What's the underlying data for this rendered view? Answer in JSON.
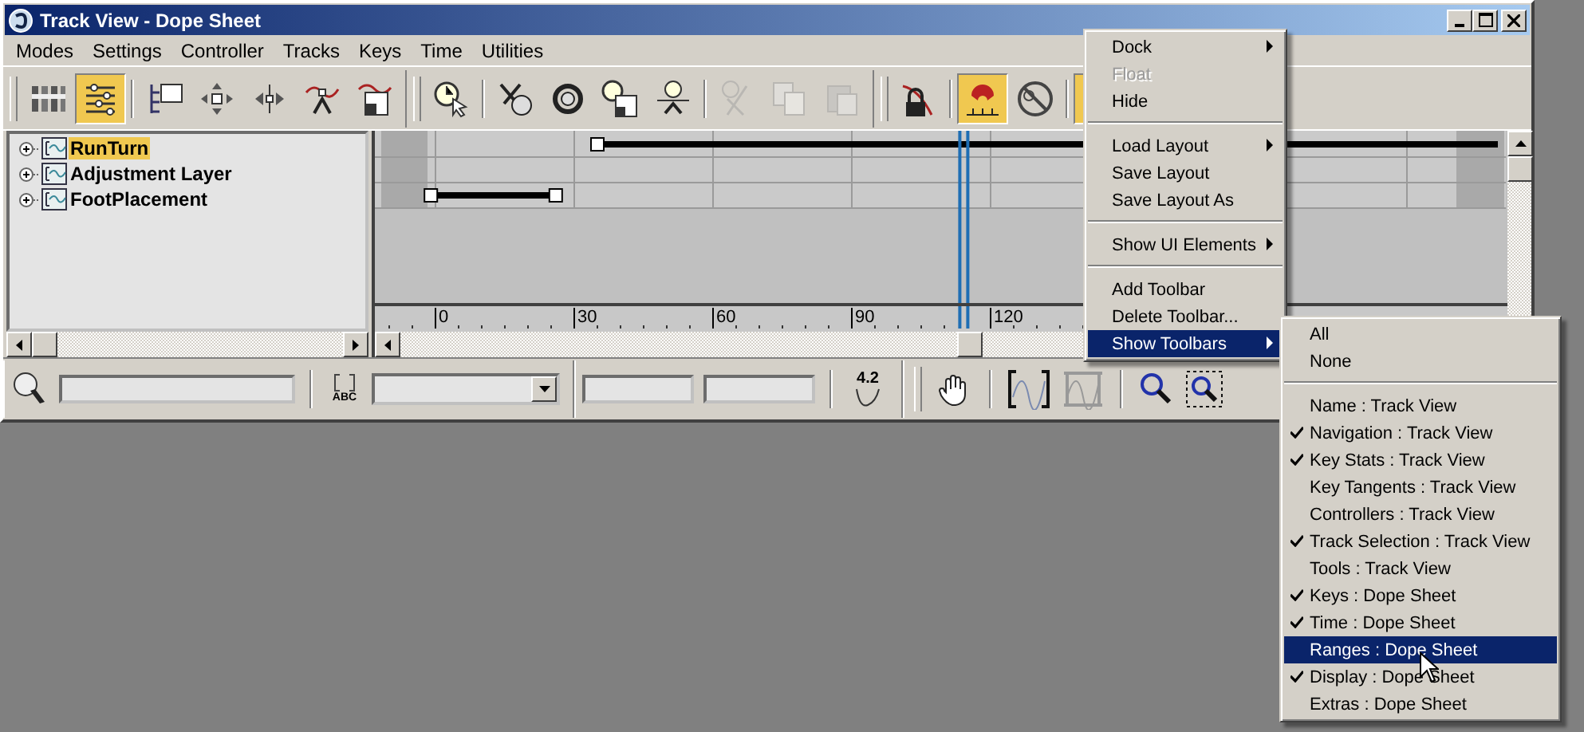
{
  "window": {
    "title": "Track View - Dope Sheet"
  },
  "menubar": [
    {
      "label": "Modes"
    },
    {
      "label": "Settings"
    },
    {
      "label": "Controller"
    },
    {
      "label": "Tracks"
    },
    {
      "label": "Keys"
    },
    {
      "label": "Time"
    },
    {
      "label": "Utilities"
    }
  ],
  "toolbars": [
    {
      "groups": [
        [
          {
            "active": false,
            "disabled": false
          },
          {
            "active": true,
            "disabled": false
          }
        ],
        [
          {
            "active": false,
            "disabled": false
          },
          {
            "active": false,
            "disabled": false
          },
          {
            "active": false,
            "disabled": false
          },
          {
            "active": false,
            "disabled": false
          },
          {
            "active": false,
            "disabled": false
          }
        ]
      ]
    },
    {
      "groups": [
        [
          {
            "active": false,
            "disabled": false
          }
        ],
        [
          {
            "active": false,
            "disabled": false
          },
          {
            "active": false,
            "disabled": false
          },
          {
            "active": false,
            "disabled": false
          },
          {
            "active": false,
            "disabled": false
          }
        ],
        [
          {
            "active": false,
            "disabled": true
          },
          {
            "active": false,
            "disabled": true
          },
          {
            "active": false,
            "disabled": true
          }
        ]
      ]
    },
    {
      "groups": [
        [
          {
            "active": false,
            "disabled": false
          }
        ],
        [
          {
            "active": true,
            "disabled": false
          },
          {
            "active": false,
            "disabled": false
          }
        ],
        [
          {
            "active": true
          }
        ]
      ]
    }
  ],
  "tree": [
    {
      "label": "RunTurn",
      "expanded": false,
      "selected": true
    },
    {
      "label": "Adjustment Layer",
      "expanded": false,
      "selected": false
    },
    {
      "label": "FootPlacement",
      "expanded": false,
      "selected": false
    }
  ],
  "ruler": [
    "0",
    "30",
    "60",
    "90",
    "120"
  ],
  "bottom_toolbar": {
    "name_icon_text": "ABC",
    "value_icon_text": "4.2"
  },
  "context_menu": [
    {
      "kind": "item",
      "label": "Dock",
      "submenu": true,
      "disabled": false,
      "selected": false
    },
    {
      "kind": "item",
      "label": "Float",
      "submenu": false,
      "disabled": true,
      "selected": false
    },
    {
      "kind": "item",
      "label": "Hide",
      "submenu": false,
      "disabled": false,
      "selected": false
    },
    {
      "kind": "separator"
    },
    {
      "kind": "item",
      "label": "Load Layout",
      "submenu": true,
      "disabled": false,
      "selected": false
    },
    {
      "kind": "item",
      "label": "Save Layout",
      "submenu": false,
      "disabled": false,
      "selected": false
    },
    {
      "kind": "item",
      "label": "Save Layout As",
      "submenu": false,
      "disabled": false,
      "selected": false
    },
    {
      "kind": "separator"
    },
    {
      "kind": "item",
      "label": "Show UI Elements",
      "submenu": true,
      "disabled": false,
      "selected": false
    },
    {
      "kind": "separator"
    },
    {
      "kind": "item",
      "label": "Add Toolbar",
      "submenu": false,
      "disabled": false,
      "selected": false
    },
    {
      "kind": "item",
      "label": "Delete Toolbar...",
      "submenu": false,
      "disabled": false,
      "selected": false
    },
    {
      "kind": "item",
      "label": "Show Toolbars",
      "submenu": true,
      "disabled": false,
      "selected": true
    }
  ],
  "submenu": [
    {
      "kind": "item",
      "label": "All",
      "checked": false,
      "selected": false
    },
    {
      "kind": "item",
      "label": "None",
      "checked": false,
      "selected": false
    },
    {
      "kind": "separator"
    },
    {
      "kind": "item",
      "label": "Name : Track View",
      "checked": false,
      "selected": false
    },
    {
      "kind": "item",
      "label": "Navigation : Track View",
      "checked": true,
      "selected": false
    },
    {
      "kind": "item",
      "label": "Key Stats : Track View",
      "checked": true,
      "selected": false
    },
    {
      "kind": "item",
      "label": "Key Tangents : Track View",
      "checked": false,
      "selected": false
    },
    {
      "kind": "item",
      "label": "Controllers : Track View",
      "checked": false,
      "selected": false
    },
    {
      "kind": "item",
      "label": "Track Selection : Track View",
      "checked": true,
      "selected": false
    },
    {
      "kind": "item",
      "label": "Tools : Track View",
      "checked": false,
      "selected": false
    },
    {
      "kind": "item",
      "label": "Keys : Dope Sheet",
      "checked": true,
      "selected": false
    },
    {
      "kind": "item",
      "label": "Time : Dope Sheet",
      "checked": true,
      "selected": false
    },
    {
      "kind": "item",
      "label": "Ranges : Dope Sheet",
      "checked": false,
      "selected": true
    },
    {
      "kind": "item",
      "label": "Display : Dope Sheet",
      "checked": true,
      "selected": false
    },
    {
      "kind": "item",
      "label": "Extras : Dope Sheet",
      "checked": false,
      "selected": false
    }
  ]
}
